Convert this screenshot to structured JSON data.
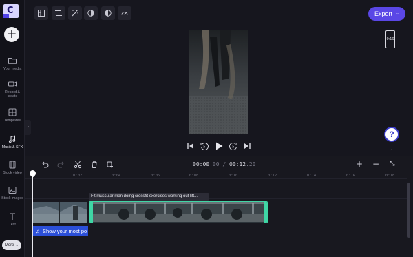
{
  "sidebar": {
    "logo_letter": "C",
    "add_button": "+",
    "items": [
      {
        "label": "Your media",
        "icon": "folder-icon"
      },
      {
        "label": "Record &\ncreate",
        "icon": "camera-icon"
      },
      {
        "label": "Templates",
        "icon": "templates-icon"
      },
      {
        "label": "Music & SFX",
        "icon": "music-icon"
      },
      {
        "label": "Stock video",
        "icon": "film-icon"
      },
      {
        "label": "Stock images",
        "icon": "image-icon"
      },
      {
        "label": "Text",
        "icon": "text-icon"
      }
    ],
    "more_label": "More ⌄"
  },
  "toolbar": {
    "tools": [
      "layout-icon",
      "crop-icon",
      "magic-wand-icon",
      "contrast-icon",
      "filter-icon",
      "speed-icon"
    ],
    "export_label": "Export",
    "export_chevron": "⌄"
  },
  "aspect_ratio": "9:16",
  "help_label": "?",
  "timeline": {
    "current_time": "00:00",
    "current_frac": ".00",
    "separator": " / ",
    "total_time": "00:12",
    "total_frac": ".20",
    "ticks": [
      "0",
      "0:02",
      "0:04",
      "0:06",
      "0:08",
      "0:10",
      "0:12",
      "0:14",
      "0:16",
      "0:18"
    ],
    "clip_title": "Fit muscular man doing crossfit exercises working out lift...",
    "audio_label": "Show your most po"
  },
  "colors": {
    "accent": "#5a47e6",
    "clip_selected": "#3fd6a5",
    "audio": "#2b4fd8"
  }
}
